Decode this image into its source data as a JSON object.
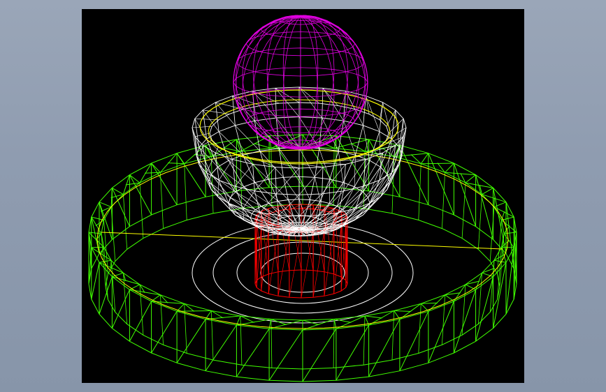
{
  "scene": {
    "background": "#000000",
    "page_background": "#8f9cb0",
    "objects": [
      {
        "name": "sphere",
        "style": "wireframe",
        "color": "#e000e0"
      },
      {
        "name": "hemispherical-bowl",
        "style": "wireframe",
        "color": "#ffffff"
      },
      {
        "name": "rim-ring",
        "style": "wireframe",
        "color": "#ffff00"
      },
      {
        "name": "cylinder-post",
        "style": "wireframe",
        "color": "#ff0000"
      },
      {
        "name": "base-ring",
        "style": "wireframe",
        "color": "#40ff00"
      },
      {
        "name": "floor-circles",
        "style": "outline",
        "color": "#ffffff"
      },
      {
        "name": "diameter-line",
        "style": "line",
        "color": "#ffff00"
      }
    ]
  }
}
